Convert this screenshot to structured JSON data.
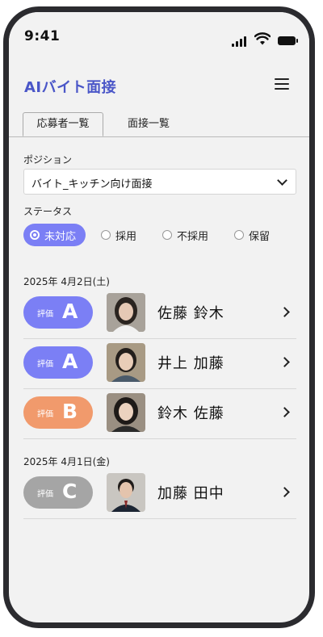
{
  "status_bar": {
    "time": "9:41"
  },
  "header": {
    "title": "AIバイト面接",
    "menu_icon": "hamburger-menu-icon"
  },
  "tabs": [
    {
      "label": "応募者一覧",
      "active": true
    },
    {
      "label": "面接一覧",
      "active": false
    }
  ],
  "filters": {
    "position_label": "ポジション",
    "position_value": "バイト_キッチン向け面接",
    "status_label": "ステータス",
    "status_options": [
      {
        "label": "未対応",
        "selected": true
      },
      {
        "label": "採用",
        "selected": false
      },
      {
        "label": "不採用",
        "selected": false
      },
      {
        "label": "保留",
        "selected": false
      }
    ]
  },
  "colors": {
    "accent": "#7b7ff5",
    "title": "#4a56c8",
    "grade_a": "#7b7ff5",
    "grade_b": "#f19a6c",
    "grade_c": "#a5a5a5"
  },
  "groups": [
    {
      "date": "2025年 4月2日(土)",
      "applicants": [
        {
          "badge_label": "評価",
          "grade": "A",
          "name": "佐藤 鈴木"
        },
        {
          "badge_label": "評価",
          "grade": "A",
          "name": "井上 加藤"
        },
        {
          "badge_label": "評価",
          "grade": "B",
          "name": "鈴木 佐藤"
        }
      ]
    },
    {
      "date": "2025年 4月1日(金)",
      "applicants": [
        {
          "badge_label": "評価",
          "grade": "C",
          "name": "加藤 田中"
        }
      ]
    }
  ]
}
